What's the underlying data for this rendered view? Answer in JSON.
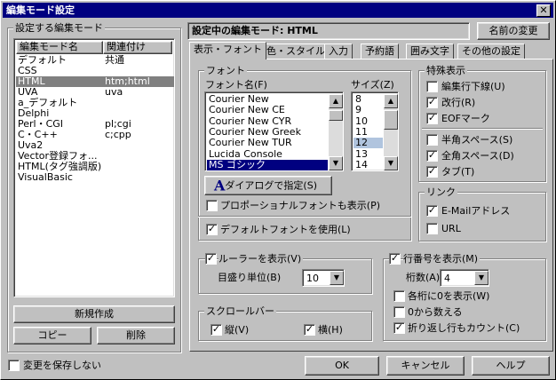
{
  "title": "編集モード設定",
  "left": {
    "group_label": "設定する編集モード",
    "col_name": "編集モード名",
    "col_assoc": "関連付け",
    "rows": [
      {
        "name": "デフォルト",
        "assoc": "共通"
      },
      {
        "name": "CSS",
        "assoc": ""
      },
      {
        "name": "HTML",
        "assoc": "htm;html"
      },
      {
        "name": "UVA",
        "assoc": "uva"
      },
      {
        "name": "a_デフォルト",
        "assoc": ""
      },
      {
        "name": "Delphi",
        "assoc": ""
      },
      {
        "name": "Perl・CGI",
        "assoc": "pl;cgi"
      },
      {
        "name": "C・C++",
        "assoc": "c;cpp"
      },
      {
        "name": "Uva2",
        "assoc": ""
      },
      {
        "name": "Vector登録フォ...",
        "assoc": ""
      },
      {
        "name": "HTML(タグ強調版)",
        "assoc": ""
      },
      {
        "name": "VisualBasic",
        "assoc": ""
      }
    ],
    "selected_index": 2,
    "new_button": "新規作成",
    "copy_button": "コピー",
    "delete_button": "削除"
  },
  "current": {
    "label": "設定中の編集モード: HTML",
    "rename_button": "名前の変更"
  },
  "tabs": [
    "表示・フォント",
    "色・スタイル",
    "入力",
    "予約語",
    "囲み文字",
    "その他の設定"
  ],
  "active_tab": 0,
  "font": {
    "group_label": "フォント",
    "name_label": "フォント名(F)",
    "size_label": "サイズ(Z)",
    "fonts": [
      "Courier New",
      "Courier New CE",
      "Courier New CYR",
      "Courier New Greek",
      "Courier New TUR",
      "Lucida Console",
      "MS ゴシック"
    ],
    "selected_font": 6,
    "sizes": [
      "8",
      "9",
      "10",
      "11",
      "12",
      "13",
      "14"
    ],
    "selected_size": 4,
    "dialog_button": "ダイアログで指定(S)",
    "dialog_icon": "A",
    "proportional_label": "プロポーショナルフォントも表示(P)",
    "proportional_checked": false
  },
  "default_font": {
    "label": "デフォルトフォントを使用(L)",
    "checked": true
  },
  "special": {
    "group_label": "特殊表示",
    "items": [
      {
        "label": "編集行下線(U)",
        "checked": false
      },
      {
        "label": "改行(R)",
        "checked": true
      },
      {
        "label": "EOFマーク",
        "checked": true
      }
    ],
    "items2": [
      {
        "label": "半角スペース(S)",
        "checked": false
      },
      {
        "label": "全角スペース(D)",
        "checked": true
      },
      {
        "label": "タブ(T)",
        "checked": true
      }
    ]
  },
  "link": {
    "group_label": "リンク",
    "items": [
      {
        "label": "E-Mailアドレス",
        "checked": true
      },
      {
        "label": "URL",
        "checked": false
      }
    ]
  },
  "ruler": {
    "label": "ルーラーを表示(V)",
    "checked": true,
    "unit_label": "目盛り単位(B)",
    "unit_value": "10"
  },
  "scrollbar": {
    "group_label": "スクロールバー",
    "vertical_label": "縦(V)",
    "vertical_checked": true,
    "horizontal_label": "横(H)",
    "horizontal_checked": true
  },
  "linenum": {
    "label": "行番号を表示(M)",
    "checked": true,
    "digits_label": "桁数(A)",
    "digits_value": "4",
    "opts": [
      {
        "label": "各桁に0を表示(W)",
        "checked": false
      },
      {
        "label": "0から数える",
        "checked": false
      },
      {
        "label": "折り返し行もカウント(C)",
        "checked": true
      }
    ]
  },
  "bottom": {
    "nosave_label": "変更を保存しない",
    "nosave_checked": false,
    "ok": "OK",
    "cancel": "キャンセル",
    "help": "ヘルプ"
  },
  "icons": {
    "close": "close-icon",
    "up": "arrow-up-icon",
    "down": "arrow-down-icon",
    "check": "checkmark-icon"
  }
}
